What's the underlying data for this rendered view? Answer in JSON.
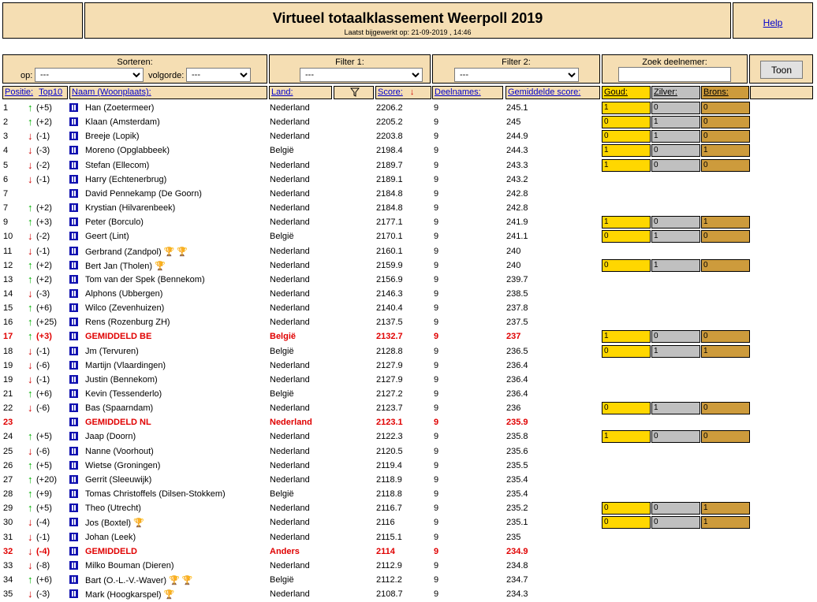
{
  "header": {
    "title": "Virtueel totaalklassement Weerpoll 2019",
    "updated": "Laatst bijgewerkt op: 21-09-2019 , 14:46",
    "help": "Help"
  },
  "controls": {
    "sort_label": "Sorteren:",
    "op_label": "op:",
    "op_value": "---",
    "volgorde_label": "volgorde:",
    "volgorde_value": "---",
    "filter1_label": "Filter 1:",
    "filter1_value": "---",
    "filter2_label": "Filter 2:",
    "filter2_value": "---",
    "search_label": "Zoek deelnemer:",
    "search_value": "",
    "toon": "Toon"
  },
  "columns": {
    "positie": "Positie:",
    "top10": "Top10",
    "naam": "Naam (Woonplaats):",
    "land": "Land:",
    "filter_icon": "funnel-icon",
    "score": "Score:",
    "score_sort_icon": "arrow-down-icon",
    "deelnames": "Deelnames:",
    "gemiddelde": "Gemiddelde score:",
    "goud": "Goud:",
    "zilver": "Zilver:",
    "brons": "Brons:"
  },
  "colors": {
    "header_bg": "#f5deb3",
    "gold": "#ffd700",
    "silver": "#c0c0c0",
    "bronze": "#cd9b3c",
    "highlight": "#e00000",
    "arrow_up": "#00b000",
    "arrow_down": "#d00000"
  },
  "rows": [
    {
      "pos": "1",
      "dir": "up",
      "delta": "(+5)",
      "name": "Han (Zoetermeer)",
      "land": "Nederland",
      "score": "2206.2",
      "deel": "9",
      "gem": "245.1",
      "medals": [
        "1",
        "0",
        "0"
      ]
    },
    {
      "pos": "2",
      "dir": "up",
      "delta": "(+2)",
      "name": "Klaan (Amsterdam)",
      "land": "Nederland",
      "score": "2205.2",
      "deel": "9",
      "gem": "245",
      "medals": [
        "0",
        "1",
        "0"
      ]
    },
    {
      "pos": "3",
      "dir": "down",
      "delta": "(-1)",
      "name": "Breeje (Lopik)",
      "land": "Nederland",
      "score": "2203.8",
      "deel": "9",
      "gem": "244.9",
      "medals": [
        "0",
        "1",
        "0"
      ]
    },
    {
      "pos": "4",
      "dir": "down",
      "delta": "(-3)",
      "name": "Moreno (Opglabbeek)",
      "land": "België",
      "score": "2198.4",
      "deel": "9",
      "gem": "244.3",
      "medals": [
        "1",
        "0",
        "1"
      ]
    },
    {
      "pos": "5",
      "dir": "down",
      "delta": "(-2)",
      "name": "Stefan (Ellecom)",
      "land": "Nederland",
      "score": "2189.7",
      "deel": "9",
      "gem": "243.3",
      "medals": [
        "1",
        "0",
        "0"
      ]
    },
    {
      "pos": "6",
      "dir": "down",
      "delta": "(-1)",
      "name": "Harry (Echtenerbrug)",
      "land": "Nederland",
      "score": "2189.1",
      "deel": "9",
      "gem": "243.2"
    },
    {
      "pos": "7",
      "dir": "",
      "delta": "",
      "name": "David Pennekamp (De Goorn)",
      "land": "Nederland",
      "score": "2184.8",
      "deel": "9",
      "gem": "242.8"
    },
    {
      "pos": "7",
      "dir": "up",
      "delta": "(+2)",
      "name": "Krystian (Hilvarenbeek)",
      "land": "Nederland",
      "score": "2184.8",
      "deel": "9",
      "gem": "242.8"
    },
    {
      "pos": "9",
      "dir": "up",
      "delta": "(+3)",
      "name": "Peter (Borculo)",
      "land": "Nederland",
      "score": "2177.1",
      "deel": "9",
      "gem": "241.9",
      "medals": [
        "1",
        "0",
        "1"
      ]
    },
    {
      "pos": "10",
      "dir": "down",
      "delta": "(-2)",
      "name": "Geert (Lint)",
      "land": "België",
      "score": "2170.1",
      "deel": "9",
      "gem": "241.1",
      "medals": [
        "0",
        "1",
        "0"
      ]
    },
    {
      "pos": "11",
      "dir": "down",
      "delta": "(-1)",
      "name": "Gerbrand (Zandpol)",
      "land": "Nederland",
      "score": "2160.1",
      "deel": "9",
      "gem": "240",
      "trophies": [
        "bronze",
        "bronze"
      ]
    },
    {
      "pos": "12",
      "dir": "up",
      "delta": "(+2)",
      "name": "Bert Jan (Tholen)",
      "land": "Nederland",
      "score": "2159.9",
      "deel": "9",
      "gem": "240",
      "trophies": [
        "bronze"
      ],
      "medals": [
        "0",
        "1",
        "0"
      ]
    },
    {
      "pos": "13",
      "dir": "up",
      "delta": "(+2)",
      "name": "Tom van der Spek (Bennekom)",
      "land": "Nederland",
      "score": "2156.9",
      "deel": "9",
      "gem": "239.7"
    },
    {
      "pos": "14",
      "dir": "down",
      "delta": "(-3)",
      "name": "Alphons (Ubbergen)",
      "land": "Nederland",
      "score": "2146.3",
      "deel": "9",
      "gem": "238.5"
    },
    {
      "pos": "15",
      "dir": "up",
      "delta": "(+6)",
      "name": "Wilco (Zevenhuizen)",
      "land": "Nederland",
      "score": "2140.4",
      "deel": "9",
      "gem": "237.8"
    },
    {
      "pos": "16",
      "dir": "up",
      "delta": "(+25)",
      "name": "Rens (Rozenburg ZH)",
      "land": "Nederland",
      "score": "2137.5",
      "deel": "9",
      "gem": "237.5"
    },
    {
      "pos": "17",
      "dir": "up",
      "delta": "(+3)",
      "name": "GEMIDDELD BE",
      "land": "België",
      "score": "2132.7",
      "deel": "9",
      "gem": "237",
      "red": true,
      "medals": [
        "1",
        "0",
        "0"
      ]
    },
    {
      "pos": "18",
      "dir": "down",
      "delta": "(-1)",
      "name": "Jm (Tervuren)",
      "land": "België",
      "score": "2128.8",
      "deel": "9",
      "gem": "236.5",
      "medals": [
        "0",
        "1",
        "1"
      ]
    },
    {
      "pos": "19",
      "dir": "down",
      "delta": "(-6)",
      "name": "Martijn (Vlaardingen)",
      "land": "Nederland",
      "score": "2127.9",
      "deel": "9",
      "gem": "236.4"
    },
    {
      "pos": "19",
      "dir": "down",
      "delta": "(-1)",
      "name": "Justin (Bennekom)",
      "land": "Nederland",
      "score": "2127.9",
      "deel": "9",
      "gem": "236.4"
    },
    {
      "pos": "21",
      "dir": "up",
      "delta": "(+6)",
      "name": "Kevin (Tessenderlo)",
      "land": "België",
      "score": "2127.2",
      "deel": "9",
      "gem": "236.4"
    },
    {
      "pos": "22",
      "dir": "down",
      "delta": "(-6)",
      "name": "Bas (Spaarndam)",
      "land": "Nederland",
      "score": "2123.7",
      "deel": "9",
      "gem": "236",
      "medals": [
        "0",
        "1",
        "0"
      ]
    },
    {
      "pos": "23",
      "dir": "",
      "delta": "",
      "name": "GEMIDDELD NL",
      "land": "Nederland",
      "score": "2123.1",
      "deel": "9",
      "gem": "235.9",
      "red": true
    },
    {
      "pos": "24",
      "dir": "up",
      "delta": "(+5)",
      "name": "Jaap (Doorn)",
      "land": "Nederland",
      "score": "2122.3",
      "deel": "9",
      "gem": "235.8",
      "medals": [
        "1",
        "0",
        "0"
      ]
    },
    {
      "pos": "25",
      "dir": "down",
      "delta": "(-6)",
      "name": "Nanne (Voorhout)",
      "land": "Nederland",
      "score": "2120.5",
      "deel": "9",
      "gem": "235.6"
    },
    {
      "pos": "26",
      "dir": "up",
      "delta": "(+5)",
      "name": "Wietse (Groningen)",
      "land": "Nederland",
      "score": "2119.4",
      "deel": "9",
      "gem": "235.5"
    },
    {
      "pos": "27",
      "dir": "up",
      "delta": "(+20)",
      "name": "Gerrit (Sleeuwijk)",
      "land": "Nederland",
      "score": "2118.9",
      "deel": "9",
      "gem": "235.4"
    },
    {
      "pos": "28",
      "dir": "up",
      "delta": "(+9)",
      "name": "Tomas Christoffels (Dilsen-Stokkem)",
      "land": "België",
      "score": "2118.8",
      "deel": "9",
      "gem": "235.4"
    },
    {
      "pos": "29",
      "dir": "up",
      "delta": "(+5)",
      "name": "Theo (Utrecht)",
      "land": "Nederland",
      "score": "2116.7",
      "deel": "9",
      "gem": "235.2",
      "medals": [
        "0",
        "0",
        "1"
      ]
    },
    {
      "pos": "30",
      "dir": "down",
      "delta": "(-4)",
      "name": "Jos (Boxtel)",
      "land": "Nederland",
      "score": "2116",
      "deel": "9",
      "gem": "235.1",
      "trophies": [
        "bronze"
      ],
      "medals": [
        "0",
        "0",
        "1"
      ]
    },
    {
      "pos": "31",
      "dir": "down",
      "delta": "(-1)",
      "name": "Johan (Leek)",
      "land": "Nederland",
      "score": "2115.1",
      "deel": "9",
      "gem": "235"
    },
    {
      "pos": "32",
      "dir": "down",
      "delta": "(-4)",
      "name": "GEMIDDELD",
      "land": "Anders",
      "score": "2114",
      "deel": "9",
      "gem": "234.9",
      "red": true
    },
    {
      "pos": "33",
      "dir": "down",
      "delta": "(-8)",
      "name": "Milko Bouman (Dieren)",
      "land": "Nederland",
      "score": "2112.9",
      "deel": "9",
      "gem": "234.8"
    },
    {
      "pos": "34",
      "dir": "up",
      "delta": "(+6)",
      "name": "Bart (O.-L.-V.-Waver)",
      "land": "België",
      "score": "2112.2",
      "deel": "9",
      "gem": "234.7",
      "trophies": [
        "gold",
        "gold"
      ]
    },
    {
      "pos": "35",
      "dir": "down",
      "delta": "(-3)",
      "name": "Mark (Hoogkarspel)",
      "land": "Nederland",
      "score": "2108.7",
      "deel": "9",
      "gem": "234.3",
      "trophies": [
        "silver"
      ]
    }
  ]
}
